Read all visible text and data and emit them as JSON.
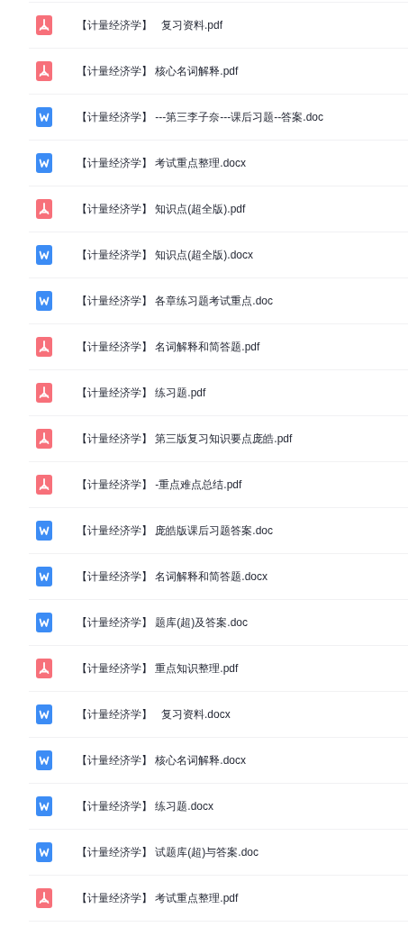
{
  "files": [
    {
      "kind": "pdf",
      "name": "【计量经济学】   复习资料.pdf"
    },
    {
      "kind": "pdf",
      "name": "【计量经济学】 核心名词解释.pdf"
    },
    {
      "kind": "word",
      "name": "【计量经济学】 ---第三李子奈---课后习题--答案.doc"
    },
    {
      "kind": "word",
      "name": "【计量经济学】 考试重点整理.docx"
    },
    {
      "kind": "pdf",
      "name": "【计量经济学】 知识点(超全版).pdf"
    },
    {
      "kind": "word",
      "name": "【计量经济学】 知识点(超全版).docx"
    },
    {
      "kind": "word",
      "name": "【计量经济学】 各章练习题考试重点.doc"
    },
    {
      "kind": "pdf",
      "name": "【计量经济学】 名词解释和简答题.pdf"
    },
    {
      "kind": "pdf",
      "name": "【计量经济学】 练习题.pdf"
    },
    {
      "kind": "pdf",
      "name": "【计量经济学】 第三版复习知识要点庞皓.pdf"
    },
    {
      "kind": "pdf",
      "name": "【计量经济学】 -重点难点总结.pdf"
    },
    {
      "kind": "word",
      "name": "【计量经济学】 庞皓版课后习题答案.doc"
    },
    {
      "kind": "word",
      "name": "【计量经济学】 名词解释和简答题.docx"
    },
    {
      "kind": "word",
      "name": "【计量经济学】 题库(超)及答案.doc"
    },
    {
      "kind": "pdf",
      "name": "【计量经济学】 重点知识整理.pdf"
    },
    {
      "kind": "word",
      "name": "【计量经济学】   复习资料.docx"
    },
    {
      "kind": "word",
      "name": "【计量经济学】 核心名词解释.docx"
    },
    {
      "kind": "word",
      "name": "【计量经济学】 练习题.docx"
    },
    {
      "kind": "word",
      "name": "【计量经济学】 试题库(超)与答案.doc"
    },
    {
      "kind": "pdf",
      "name": "【计量经济学】 考试重点整理.pdf"
    }
  ]
}
